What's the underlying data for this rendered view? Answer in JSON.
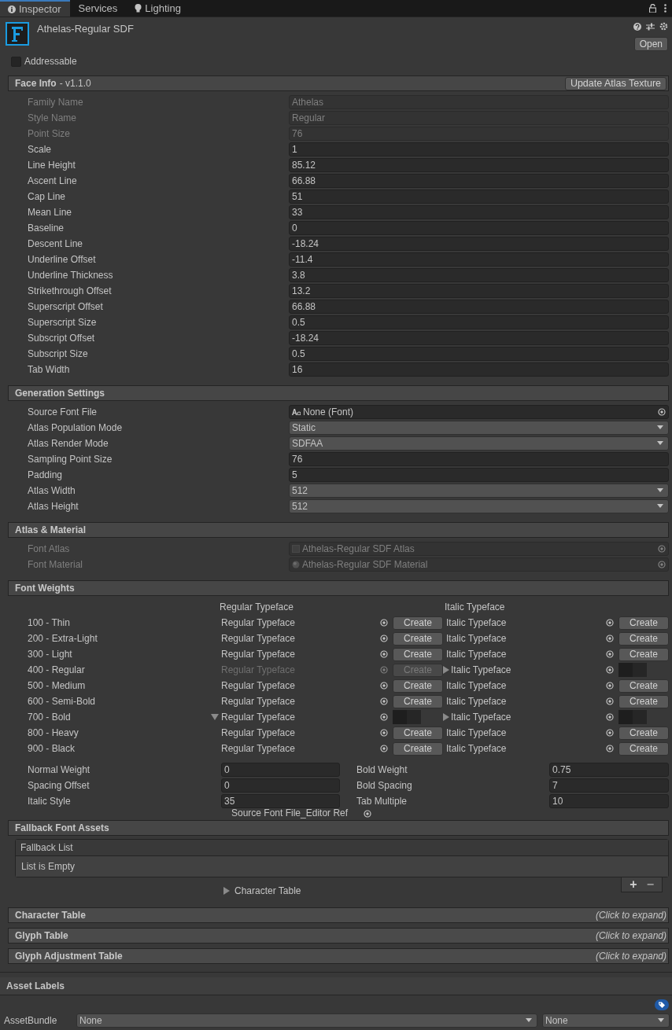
{
  "tabs": [
    {
      "label": "Inspector",
      "kind": "info",
      "selected": true
    },
    {
      "label": "Services",
      "kind": "plain",
      "selected": false
    },
    {
      "label": "Lighting",
      "kind": "bulb",
      "selected": false
    }
  ],
  "asset": {
    "title": "Athelas-Regular SDF",
    "open_button": "Open"
  },
  "addressable": {
    "label": "Addressable",
    "checked": false
  },
  "sections": [
    {
      "kind": "fields",
      "title": "Face Info",
      "subtitle": "- v1.1.0",
      "button": "Update Atlas Texture",
      "fields": [
        {
          "kind": "text",
          "label": "Family Name",
          "value": "Athelas",
          "disabled": true
        },
        {
          "kind": "text",
          "label": "Style Name",
          "value": "Regular",
          "disabled": true
        },
        {
          "kind": "text",
          "label": "Point Size",
          "value": "76",
          "disabled": true
        },
        {
          "kind": "text",
          "label": "Scale",
          "value": "1",
          "disabled": false
        },
        {
          "kind": "text",
          "label": "Line Height",
          "value": "85.12",
          "disabled": false
        },
        {
          "kind": "text",
          "label": "Ascent Line",
          "value": "66.88",
          "disabled": false
        },
        {
          "kind": "text",
          "label": "Cap Line",
          "value": "51",
          "disabled": false
        },
        {
          "kind": "text",
          "label": "Mean Line",
          "value": "33",
          "disabled": false
        },
        {
          "kind": "text",
          "label": "Baseline",
          "value": "0",
          "disabled": false
        },
        {
          "kind": "text",
          "label": "Descent Line",
          "value": "-18.24",
          "disabled": false
        },
        {
          "kind": "text",
          "label": "Underline Offset",
          "value": "-11.4",
          "disabled": false
        },
        {
          "kind": "text",
          "label": "Underline Thickness",
          "value": "3.8",
          "disabled": false
        },
        {
          "kind": "text",
          "label": "Strikethrough Offset",
          "value": "13.2",
          "disabled": false
        },
        {
          "kind": "text",
          "label": "Superscript Offset",
          "value": "66.88",
          "disabled": false
        },
        {
          "kind": "text",
          "label": "Superscript Size",
          "value": "0.5",
          "disabled": false
        },
        {
          "kind": "text",
          "label": "Subscript Offset",
          "value": "-18.24",
          "disabled": false
        },
        {
          "kind": "text",
          "label": "Subscript Size",
          "value": "0.5",
          "disabled": false
        },
        {
          "kind": "text",
          "label": "Tab Width",
          "value": "16",
          "disabled": false
        }
      ]
    },
    {
      "kind": "fields",
      "title": "Generation Settings",
      "fields": [
        {
          "kind": "font_ref",
          "label": "Source Font File",
          "value": "None (Font)",
          "disabled": false
        },
        {
          "kind": "dropdown",
          "label": "Atlas Population Mode",
          "value": "Static",
          "disabled": false
        },
        {
          "kind": "dropdown",
          "label": "Atlas Render Mode",
          "value": "SDFAA",
          "disabled": false
        },
        {
          "kind": "text",
          "label": "Sampling Point Size",
          "value": "76",
          "disabled": false
        },
        {
          "kind": "text",
          "label": "Padding",
          "value": "5",
          "disabled": false
        },
        {
          "kind": "dropdown",
          "label": "Atlas Width",
          "value": "512",
          "disabled": false
        },
        {
          "kind": "dropdown",
          "label": "Atlas Height",
          "value": "512",
          "disabled": false
        }
      ]
    },
    {
      "kind": "fields",
      "title": "Atlas & Material",
      "fields": [
        {
          "kind": "texture_ref",
          "label": "Font Atlas",
          "value": "Athelas-Regular SDF Atlas",
          "disabled": true
        },
        {
          "kind": "material_ref",
          "label": "Font Material",
          "value": "Athelas-Regular SDF Material",
          "disabled": true
        }
      ]
    },
    {
      "kind": "weights",
      "title": "Font Weights",
      "columns": [
        "Regular Typeface",
        "Italic Typeface"
      ],
      "rows": [
        {
          "label": "100 - Thin",
          "regular": {
            "kind": "create",
            "text": "Regular Typeface",
            "button": "Create",
            "disabled": false
          },
          "italic": {
            "kind": "create",
            "text": "Italic Typeface",
            "button": "Create",
            "disabled": false
          }
        },
        {
          "label": "200 - Extra-Light",
          "regular": {
            "kind": "create",
            "text": "Regular Typeface",
            "button": "Create",
            "disabled": false
          },
          "italic": {
            "kind": "create",
            "text": "Italic Typeface",
            "button": "Create",
            "disabled": false
          }
        },
        {
          "label": "300 - Light",
          "regular": {
            "kind": "create",
            "text": "Regular Typeface",
            "button": "Create",
            "disabled": false
          },
          "italic": {
            "kind": "create",
            "text": "Italic Typeface",
            "button": "Create",
            "disabled": false
          }
        },
        {
          "label": "400 - Regular",
          "regular": {
            "kind": "create",
            "text": "Regular Typeface",
            "button": "Create",
            "disabled": true
          },
          "italic": {
            "kind": "foldout",
            "text": "Italic Typeface",
            "expanded": false,
            "disabled": false
          }
        },
        {
          "label": "500 - Medium",
          "regular": {
            "kind": "create",
            "text": "Regular Typeface",
            "button": "Create",
            "disabled": false
          },
          "italic": {
            "kind": "create",
            "text": "Italic Typeface",
            "button": "Create",
            "disabled": false
          }
        },
        {
          "label": "600 - Semi-Bold",
          "regular": {
            "kind": "create",
            "text": "Regular Typeface",
            "button": "Create",
            "disabled": false
          },
          "italic": {
            "kind": "create",
            "text": "Italic Typeface",
            "button": "Create",
            "disabled": false
          }
        },
        {
          "label": "700 - Bold",
          "regular": {
            "kind": "foldout",
            "text": "Regular Typeface",
            "expanded": true,
            "disabled": false
          },
          "italic": {
            "kind": "foldout",
            "text": "Italic Typeface",
            "expanded": false,
            "disabled": false
          }
        },
        {
          "label": "800 - Heavy",
          "regular": {
            "kind": "create",
            "text": "Regular Typeface",
            "button": "Create",
            "disabled": false
          },
          "italic": {
            "kind": "create",
            "text": "Italic Typeface",
            "button": "Create",
            "disabled": false
          }
        },
        {
          "label": "900 - Black",
          "regular": {
            "kind": "create",
            "text": "Regular Typeface",
            "button": "Create",
            "disabled": false
          },
          "italic": {
            "kind": "create",
            "text": "Italic Typeface",
            "button": "Create",
            "disabled": false
          }
        }
      ],
      "settings": [
        {
          "label": "Normal Weight",
          "value": "0"
        },
        {
          "label": "Bold Weight",
          "value": "0.75"
        },
        {
          "label": "Spacing Offset",
          "value": "0"
        },
        {
          "label": "Bold Spacing",
          "value": "7"
        },
        {
          "label": "Italic Style",
          "value": "35"
        },
        {
          "label": "Tab Multiple",
          "value": "10"
        }
      ],
      "extra": {
        "kind": "object_ref",
        "text": "Source Font File_Editor Ref"
      }
    },
    {
      "kind": "list",
      "title": "Fallback Font Assets",
      "list_title": "Fallback List",
      "empty_text": "List is Empty",
      "buttons": [
        "+",
        "−"
      ],
      "extra": {
        "kind": "foldout",
        "text": "Character Table"
      }
    },
    {
      "kind": "collapsed",
      "title": "Character Table",
      "hint": "(Click to expand)"
    },
    {
      "kind": "collapsed",
      "title": "Glyph Table",
      "hint": "(Click to expand)"
    },
    {
      "kind": "collapsed",
      "title": "Glyph Adjustment Table",
      "hint": "(Click to expand)"
    }
  ],
  "asset_labels": {
    "title": "Asset Labels",
    "bundle_label": "AssetBundle",
    "bundle": "None",
    "variant": "None"
  }
}
